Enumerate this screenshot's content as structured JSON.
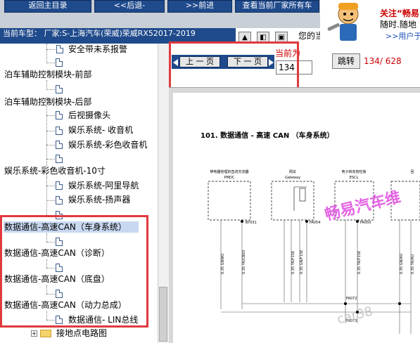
{
  "top_buttons": [
    "返回主目录",
    "<<后退-",
    ">>前进",
    "查看当前厂家所有车"
  ],
  "car_bar": {
    "text": "当前车型：  厂家:S-上海汽车(荣威)荣威RX52017-2019",
    "current_text": "您的当"
  },
  "ad": {
    "title": "关注“畅易",
    "subtitle": "随时.随地",
    "link": ">>用户于"
  },
  "tree": {
    "items": [
      {
        "label": "安全带未系报警",
        "kind": "doc"
      },
      {
        "label": "",
        "kind": "doc-only"
      },
      {
        "label": "泊车辅助控制模块-前部",
        "kind": "folder"
      },
      {
        "label": "",
        "kind": "doc-only"
      },
      {
        "label": "泊车辅助控制模块-后部",
        "kind": "folder"
      },
      {
        "label": "后视摄像头",
        "kind": "doc"
      },
      {
        "label": "娱乐系统- 收音机",
        "kind": "doc"
      },
      {
        "label": "娱乐系统-彩色收音机",
        "kind": "doc"
      },
      {
        "label": "",
        "kind": "doc-only"
      },
      {
        "label": "娱乐系统-彩色收音机-10寸",
        "kind": "folder"
      },
      {
        "label": "娱乐系统-阿里导航",
        "kind": "doc"
      },
      {
        "label": "娱乐系统-扬声器",
        "kind": "doc"
      },
      {
        "label": "",
        "kind": "doc-only"
      },
      {
        "label": "数据通信-高速CAN（车身系统）",
        "kind": "folder"
      },
      {
        "label": "",
        "kind": "doc-only"
      },
      {
        "label": "数据通信-高速CAN（诊断）",
        "kind": "folder"
      },
      {
        "label": "",
        "kind": "doc-only"
      },
      {
        "label": "数据通信-高速CAN（底盘）",
        "kind": "folder"
      },
      {
        "label": "",
        "kind": "doc-only"
      },
      {
        "label": "数据通信-高速CAN（动力总成）",
        "kind": "folder"
      },
      {
        "label": "数据通信- LIN总线",
        "kind": "doc"
      },
      {
        "label": "接地点电路图",
        "kind": "folder-icon"
      }
    ],
    "selected": "数据通信-高速CAN（车身系统）"
  },
  "viewer": {
    "prev_label": "上 一 页",
    "next_label": "下 一 页",
    "page_label": "当前为",
    "page_value": "134",
    "jump_label": "跳转",
    "page_count": "134/ 628"
  },
  "document": {
    "title": "101. 数据通信 - 高速 CAN （车身系统）",
    "modules": [
      {
        "name": "带电器管理的直流交流器",
        "code": "PMDC"
      },
      {
        "name": "网关",
        "code": "Gateway"
      },
      {
        "name": "电子转向管柱锁",
        "code": "ESCL"
      },
      {
        "name": "回",
        "code": ""
      }
    ],
    "connectors": [
      "BY031",
      "FA054",
      "FA050",
      "FA072",
      "FA073"
    ],
    "wire_labels": [
      "0.35 GNWO",
      "0.35 YR/CB03",
      "0.35 YR/F15E",
      "0.35 GN/F15E",
      "0.35 YR/F15E",
      "0.35 GN/AU",
      "0.35 YR/AU"
    ],
    "watermark": "畅易汽车维",
    "watermark2": "car38"
  }
}
